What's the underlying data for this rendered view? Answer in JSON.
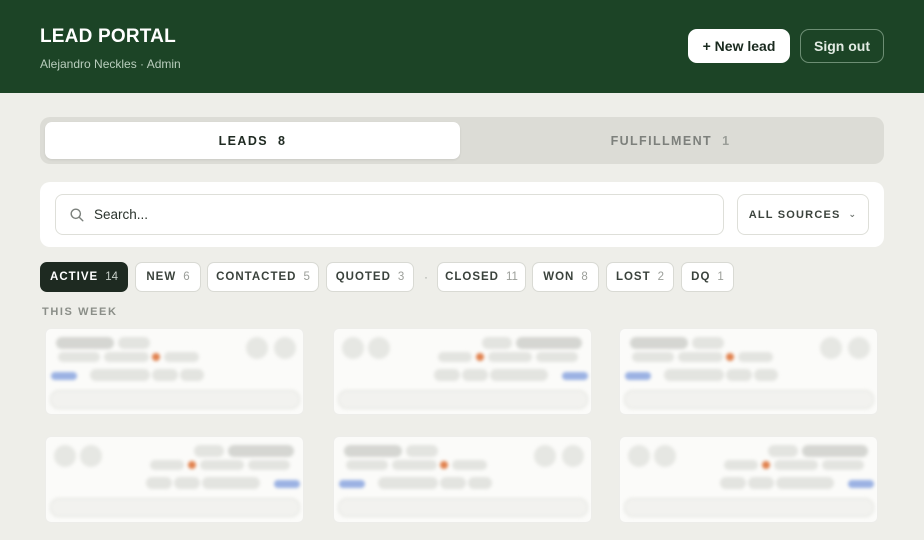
{
  "header": {
    "title": "LEAD PORTAL",
    "subtitle": "Alejandro Neckles · Admin",
    "new_lead_label": "+ New lead",
    "sign_out_label": "Sign out"
  },
  "tabs": [
    {
      "label": "LEADS",
      "count": "8",
      "active": true
    },
    {
      "label": "FULFILLMENT",
      "count": "1",
      "active": false
    }
  ],
  "search": {
    "placeholder": "Search...",
    "value": "",
    "source_label": "ALL SOURCES"
  },
  "filters": [
    {
      "label": "ACTIVE",
      "count": "14",
      "active": true
    },
    {
      "label": "NEW",
      "count": "6"
    },
    {
      "label": "CONTACTED",
      "count": "5"
    },
    {
      "label": "QUOTED",
      "count": "3"
    },
    {
      "label": "CLOSED",
      "count": "11"
    },
    {
      "label": "WON",
      "count": "8"
    },
    {
      "label": "LOST",
      "count": "2"
    },
    {
      "label": "DQ",
      "count": "1"
    }
  ],
  "filter_separator": "·",
  "section": {
    "label": "THIS WEEK"
  },
  "colors": {
    "header_bg": "#1c4426",
    "page_bg": "#eeeee9",
    "active_chip": "#1e2a21",
    "status_dot": "#e0814e",
    "link_blue": "#9bb2e3"
  },
  "icons": {
    "search": "search-icon",
    "chevron": "chevron-down-icon",
    "phone": "phone-icon",
    "notes": "pencil-icon"
  }
}
